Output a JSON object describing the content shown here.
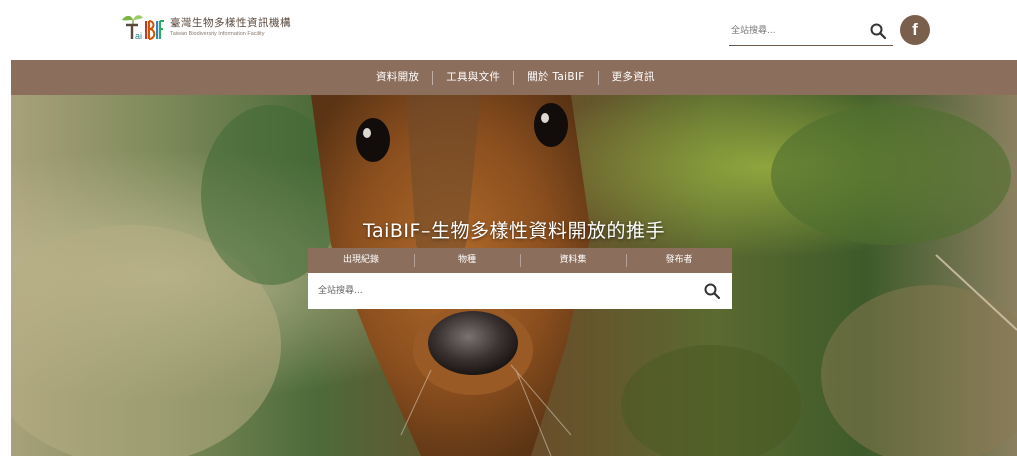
{
  "header": {
    "logo_title": "臺灣生物多樣性資訊機構",
    "logo_subtitle": "Taiwan Biodiversity Information Facility",
    "search_placeholder": "全站搜尋...",
    "facebook_glyph": "f"
  },
  "nav": {
    "items": [
      {
        "label": "資料開放"
      },
      {
        "label": "工具與文件"
      },
      {
        "label": "關於 TaiBIF"
      },
      {
        "label": "更多資訊"
      }
    ]
  },
  "hero": {
    "title": "TaiBIF–生物多樣性資料開放的推手",
    "tabs": [
      {
        "label": "出現紀錄"
      },
      {
        "label": "物種"
      },
      {
        "label": "資料集"
      },
      {
        "label": "發布者"
      }
    ],
    "search_placeholder": "全站搜尋..."
  },
  "icons": {
    "search": "search-icon",
    "facebook": "facebook-icon",
    "logo": "taibif-logo"
  },
  "colors": {
    "brand_brown": "#8c6e5d",
    "facebook_bg": "#7a5f4d",
    "logo_text": "#5a4a3e"
  }
}
